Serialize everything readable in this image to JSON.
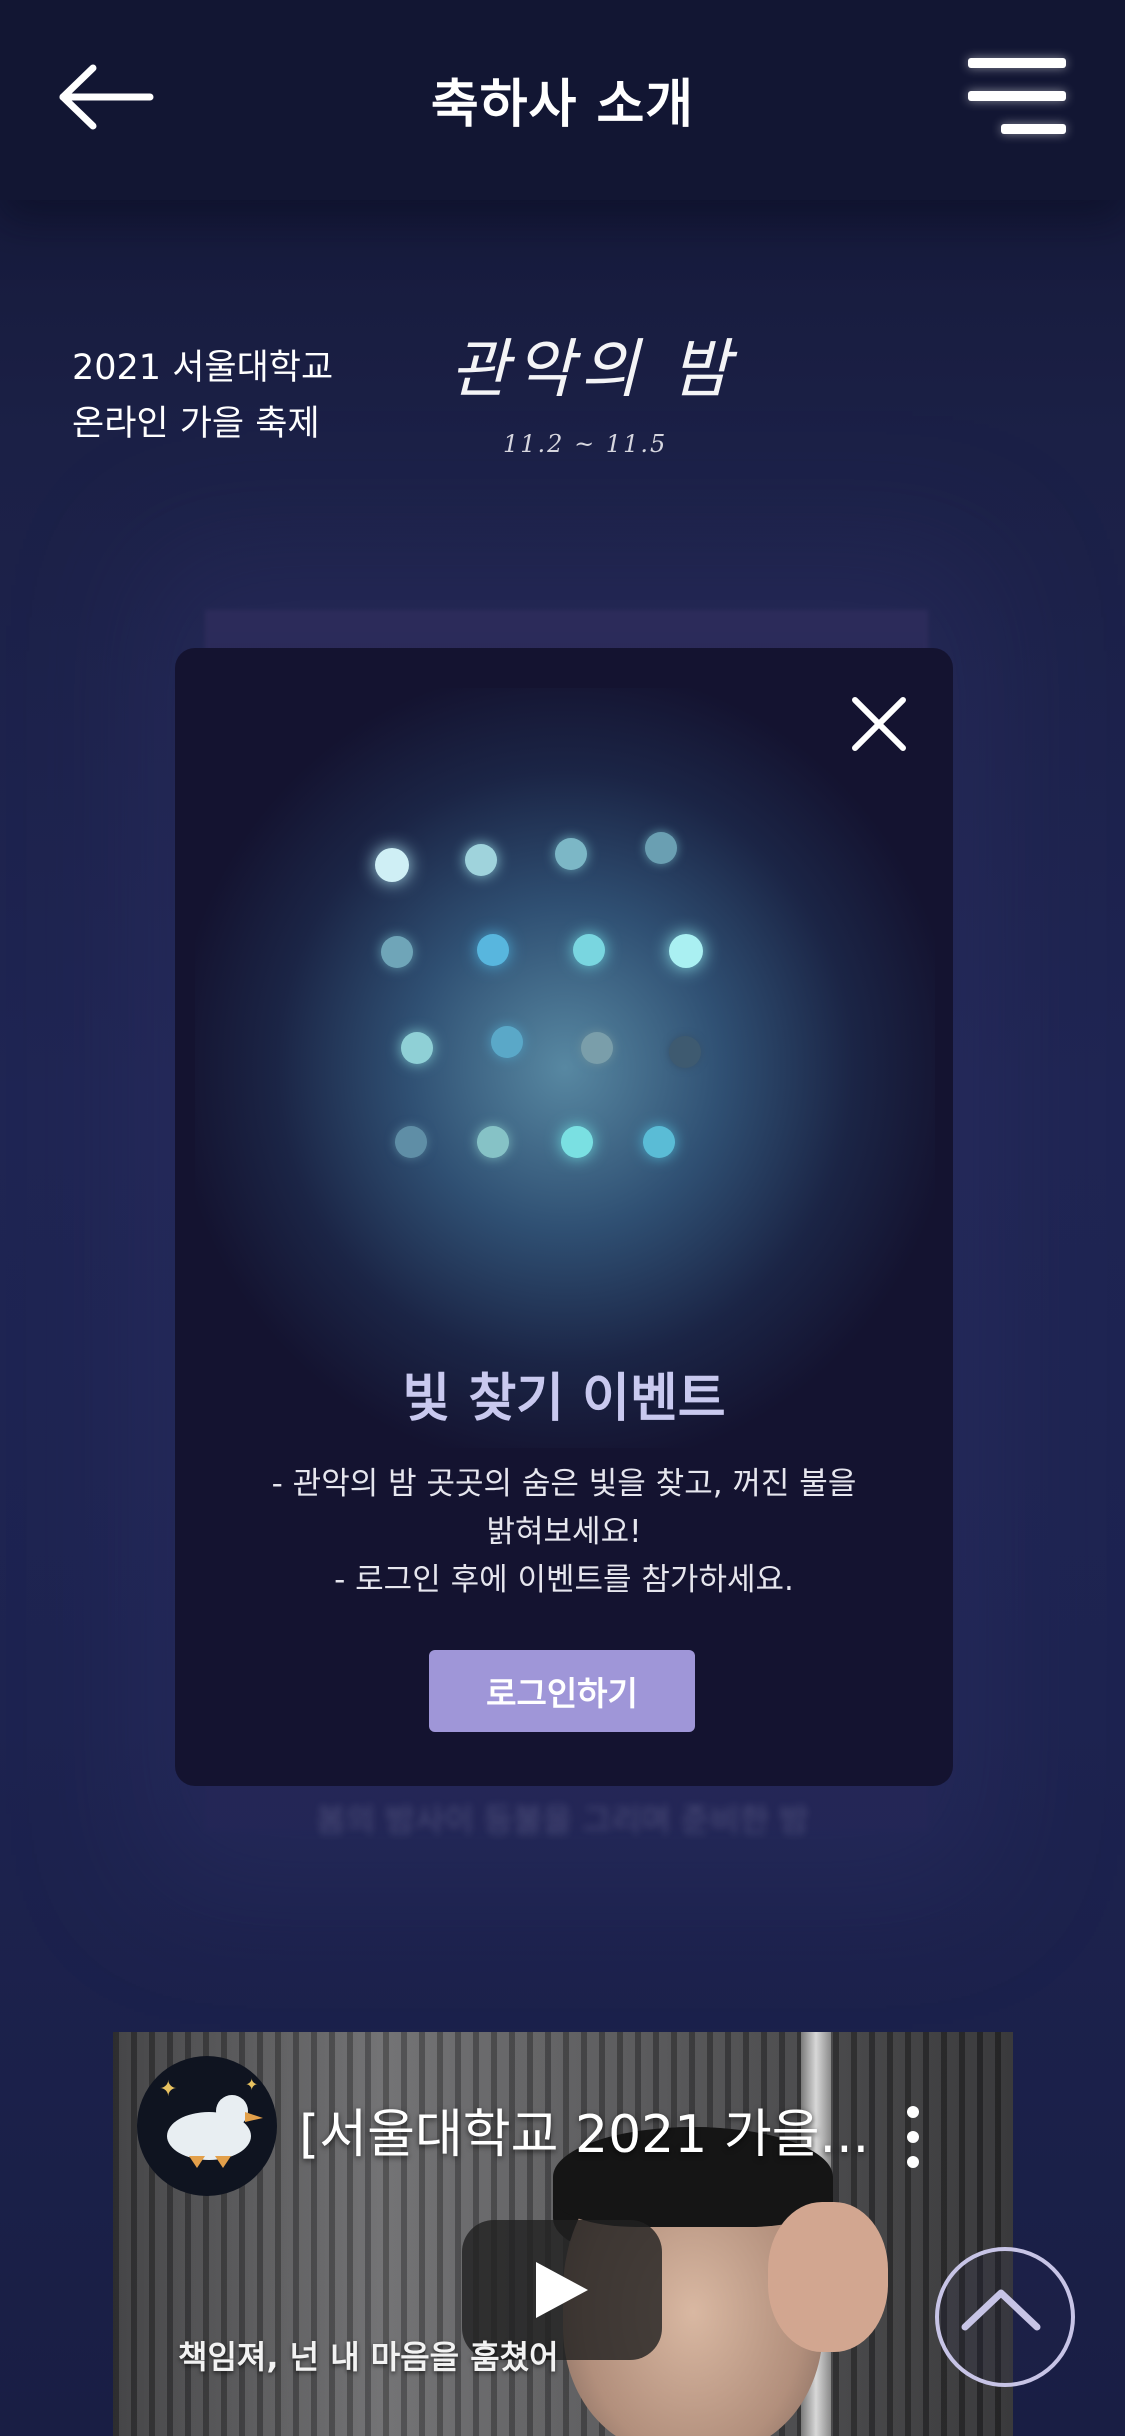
{
  "header": {
    "title": "축하사 소개",
    "back_icon": "arrow-left-icon",
    "menu_icon": "hamburger-menu-icon"
  },
  "festival": {
    "line1": "2021 서울대학교",
    "line2": "온라인 가을 축제",
    "script_title": "관악의 밤",
    "script_date": "11.2 ~ 11.5"
  },
  "background": {
    "blurred_caption": "봄의 밤사이 등불을 그리며 준비한 밤"
  },
  "modal": {
    "close_icon": "close-icon",
    "title": "빛 찾기 이벤트",
    "desc_line1": "- 관악의 밤 곳곳의 숨은 빛을 찾고, 꺼진 불을",
    "desc_line2": "밝혀보세요!",
    "desc_line3": "- 로그인 후에 이벤트를 참가하세요.",
    "login_button": "로그인하기",
    "colors": {
      "button": "#9f96d8",
      "title": "#c9c9ef",
      "panel": "#141330"
    }
  },
  "video": {
    "title": "[서울대학교 2021 가을...",
    "subtitle": "책임져, 넌 내 마음을 훔쳤어",
    "play_icon": "play-icon",
    "more_icon": "more-vertical-icon",
    "avatar_icon": "duck-avatar-icon"
  },
  "scroll_top": {
    "icon": "chevron-up-icon"
  }
}
